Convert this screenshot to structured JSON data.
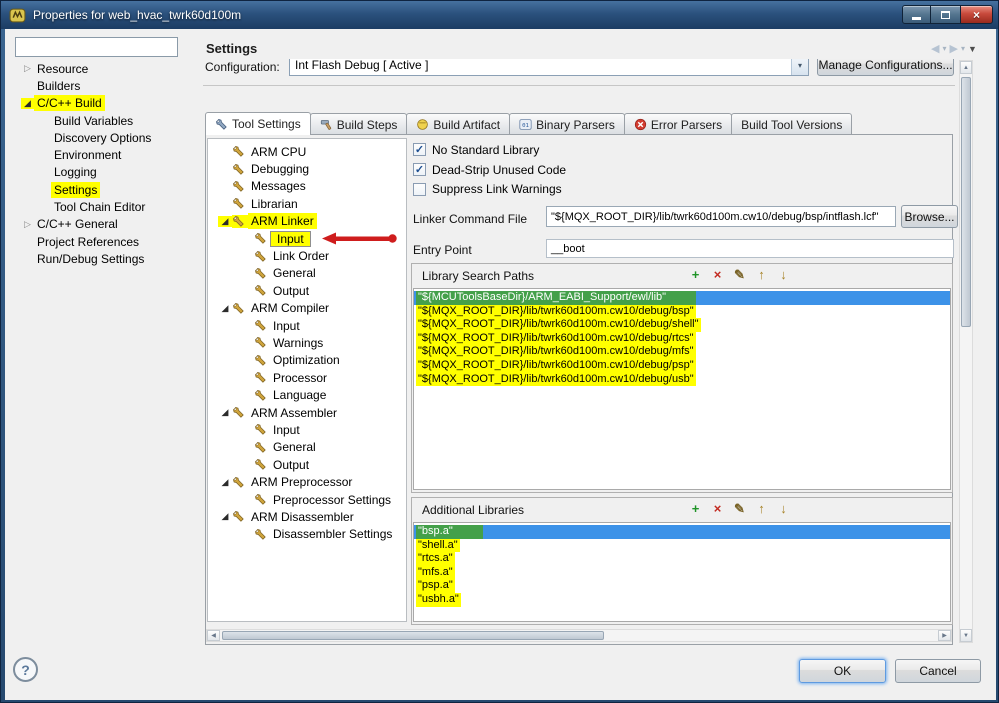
{
  "window": {
    "title": "Properties for web_hvac_twrk60d100m"
  },
  "icons": {
    "close": "×",
    "dropdown": "▾",
    "menu": "▼",
    "back": "◀",
    "forward": "▶",
    "scroll_up": "▲",
    "scroll_down": "▼",
    "scroll_left": "◀",
    "scroll_right": "▶",
    "check": "✓",
    "collapsed": "▷",
    "expanded": "◢",
    "add": "+",
    "delete": "×",
    "edit": "✎",
    "move_up": "↑",
    "move_down": "↓"
  },
  "sidebar": {
    "filter_value": "",
    "tree": [
      {
        "label": "Resource",
        "level": 1,
        "arrow": "collapsed"
      },
      {
        "label": "Builders",
        "level": 1,
        "arrow": "none"
      },
      {
        "label": "C/C++ Build",
        "level": 1,
        "arrow": "expanded",
        "highlight": true
      },
      {
        "label": "Build Variables",
        "level": 2,
        "arrow": "none"
      },
      {
        "label": "Discovery Options",
        "level": 2,
        "arrow": "none"
      },
      {
        "label": "Environment",
        "level": 2,
        "arrow": "none"
      },
      {
        "label": "Logging",
        "level": 2,
        "arrow": "none"
      },
      {
        "label": "Settings",
        "level": 2,
        "arrow": "none",
        "highlight": true
      },
      {
        "label": "Tool Chain Editor",
        "level": 2,
        "arrow": "none"
      },
      {
        "label": "C/C++ General",
        "level": 1,
        "arrow": "collapsed"
      },
      {
        "label": "Project References",
        "level": 1,
        "arrow": "none"
      },
      {
        "label": "Run/Debug Settings",
        "level": 1,
        "arrow": "none"
      }
    ]
  },
  "header": {
    "title": "Settings"
  },
  "configuration": {
    "label": "Configuration:",
    "value": "Int Flash Debug  [ Active ]",
    "manage_button": "Manage Configurations..."
  },
  "tabs": [
    {
      "label": "Tool Settings",
      "icon": "wrench",
      "active": true
    },
    {
      "label": "Build Steps",
      "icon": "hammer",
      "active": false
    },
    {
      "label": "Build Artifact",
      "icon": "package",
      "active": false
    },
    {
      "label": "Binary Parsers",
      "icon": "binary",
      "active": false
    },
    {
      "label": "Error Parsers",
      "icon": "error",
      "active": false
    },
    {
      "label": "Build Tool Versions",
      "icon": "none",
      "active": false
    }
  ],
  "tool_tree": [
    {
      "label": "ARM CPU",
      "level": 0,
      "arrow": "none"
    },
    {
      "label": "Debugging",
      "level": 0,
      "arrow": "none"
    },
    {
      "label": "Messages",
      "level": 0,
      "arrow": "none"
    },
    {
      "label": "Librarian",
      "level": 0,
      "arrow": "none"
    },
    {
      "label": "ARM Linker",
      "level": 0,
      "arrow": "expanded",
      "highlight": true
    },
    {
      "label": "Input",
      "level": 1,
      "arrow": "none",
      "highlight": "box",
      "annotated": true
    },
    {
      "label": "Link Order",
      "level": 1,
      "arrow": "none"
    },
    {
      "label": "General",
      "level": 1,
      "arrow": "none"
    },
    {
      "label": "Output",
      "level": 1,
      "arrow": "none"
    },
    {
      "label": "ARM Compiler",
      "level": 0,
      "arrow": "expanded"
    },
    {
      "label": "Input",
      "level": 1,
      "arrow": "none"
    },
    {
      "label": "Warnings",
      "level": 1,
      "arrow": "none"
    },
    {
      "label": "Optimization",
      "level": 1,
      "arrow": "none"
    },
    {
      "label": "Processor",
      "level": 1,
      "arrow": "none"
    },
    {
      "label": "Language",
      "level": 1,
      "arrow": "none"
    },
    {
      "label": "ARM Assembler",
      "level": 0,
      "arrow": "expanded"
    },
    {
      "label": "Input",
      "level": 1,
      "arrow": "none"
    },
    {
      "label": "General",
      "level": 1,
      "arrow": "none"
    },
    {
      "label": "Output",
      "level": 1,
      "arrow": "none"
    },
    {
      "label": "ARM Preprocessor",
      "level": 0,
      "arrow": "expanded"
    },
    {
      "label": "Preprocessor Settings",
      "level": 1,
      "arrow": "none"
    },
    {
      "label": "ARM Disassembler",
      "level": 0,
      "arrow": "expanded"
    },
    {
      "label": "Disassembler Settings",
      "level": 1,
      "arrow": "none"
    }
  ],
  "linker_options": {
    "checkboxes": [
      {
        "label": "No Standard Library",
        "checked": true
      },
      {
        "label": "Dead-Strip Unused Code",
        "checked": true
      },
      {
        "label": "Suppress Link Warnings",
        "checked": false
      }
    ],
    "linker_command_file_label": "Linker Command File",
    "linker_command_file_value": "\"${MQX_ROOT_DIR}/lib/twrk60d100m.cw10/debug/bsp/intflash.lcf\"",
    "browse_button": "Browse...",
    "entry_point_label": "Entry Point",
    "entry_point_value": "__boot"
  },
  "library_search_paths": {
    "title": "Library Search Paths",
    "toolbar": [
      "add",
      "delete",
      "edit",
      "move_up",
      "move_down"
    ],
    "items": [
      {
        "text": "\"${MCUToolsBaseDir}/ARM_EABI_Support/ewl/lib\"",
        "selected": true,
        "highlight": "green"
      },
      {
        "text": "\"${MQX_ROOT_DIR}/lib/twrk60d100m.cw10/debug/bsp\"",
        "highlight": "yellow"
      },
      {
        "text": "\"${MQX_ROOT_DIR}/lib/twrk60d100m.cw10/debug/shell\"",
        "highlight": "yellow"
      },
      {
        "text": "\"${MQX_ROOT_DIR}/lib/twrk60d100m.cw10/debug/rtcs\"",
        "highlight": "yellow"
      },
      {
        "text": "\"${MQX_ROOT_DIR}/lib/twrk60d100m.cw10/debug/mfs\"",
        "highlight": "yellow"
      },
      {
        "text": "\"${MQX_ROOT_DIR}/lib/twrk60d100m.cw10/debug/psp\"",
        "highlight": "yellow"
      },
      {
        "text": "\"${MQX_ROOT_DIR}/lib/twrk60d100m.cw10/debug/usb\"",
        "highlight": "yellow"
      }
    ]
  },
  "additional_libraries": {
    "title": "Additional Libraries",
    "toolbar": [
      "add",
      "delete",
      "edit",
      "move_up",
      "move_down"
    ],
    "items": [
      {
        "text": "\"bsp.a\"",
        "selected": true,
        "highlight": "green"
      },
      {
        "text": "\"shell.a\"",
        "highlight": "yellow"
      },
      {
        "text": "\"rtcs.a\"",
        "highlight": "yellow"
      },
      {
        "text": "\"mfs.a\"",
        "highlight": "yellow"
      },
      {
        "text": "\"psp.a\"",
        "highlight": "yellow"
      },
      {
        "text": "\"usbh.a\"",
        "highlight": "yellow"
      }
    ]
  },
  "footer": {
    "help": "?",
    "ok": "OK",
    "cancel": "Cancel"
  }
}
